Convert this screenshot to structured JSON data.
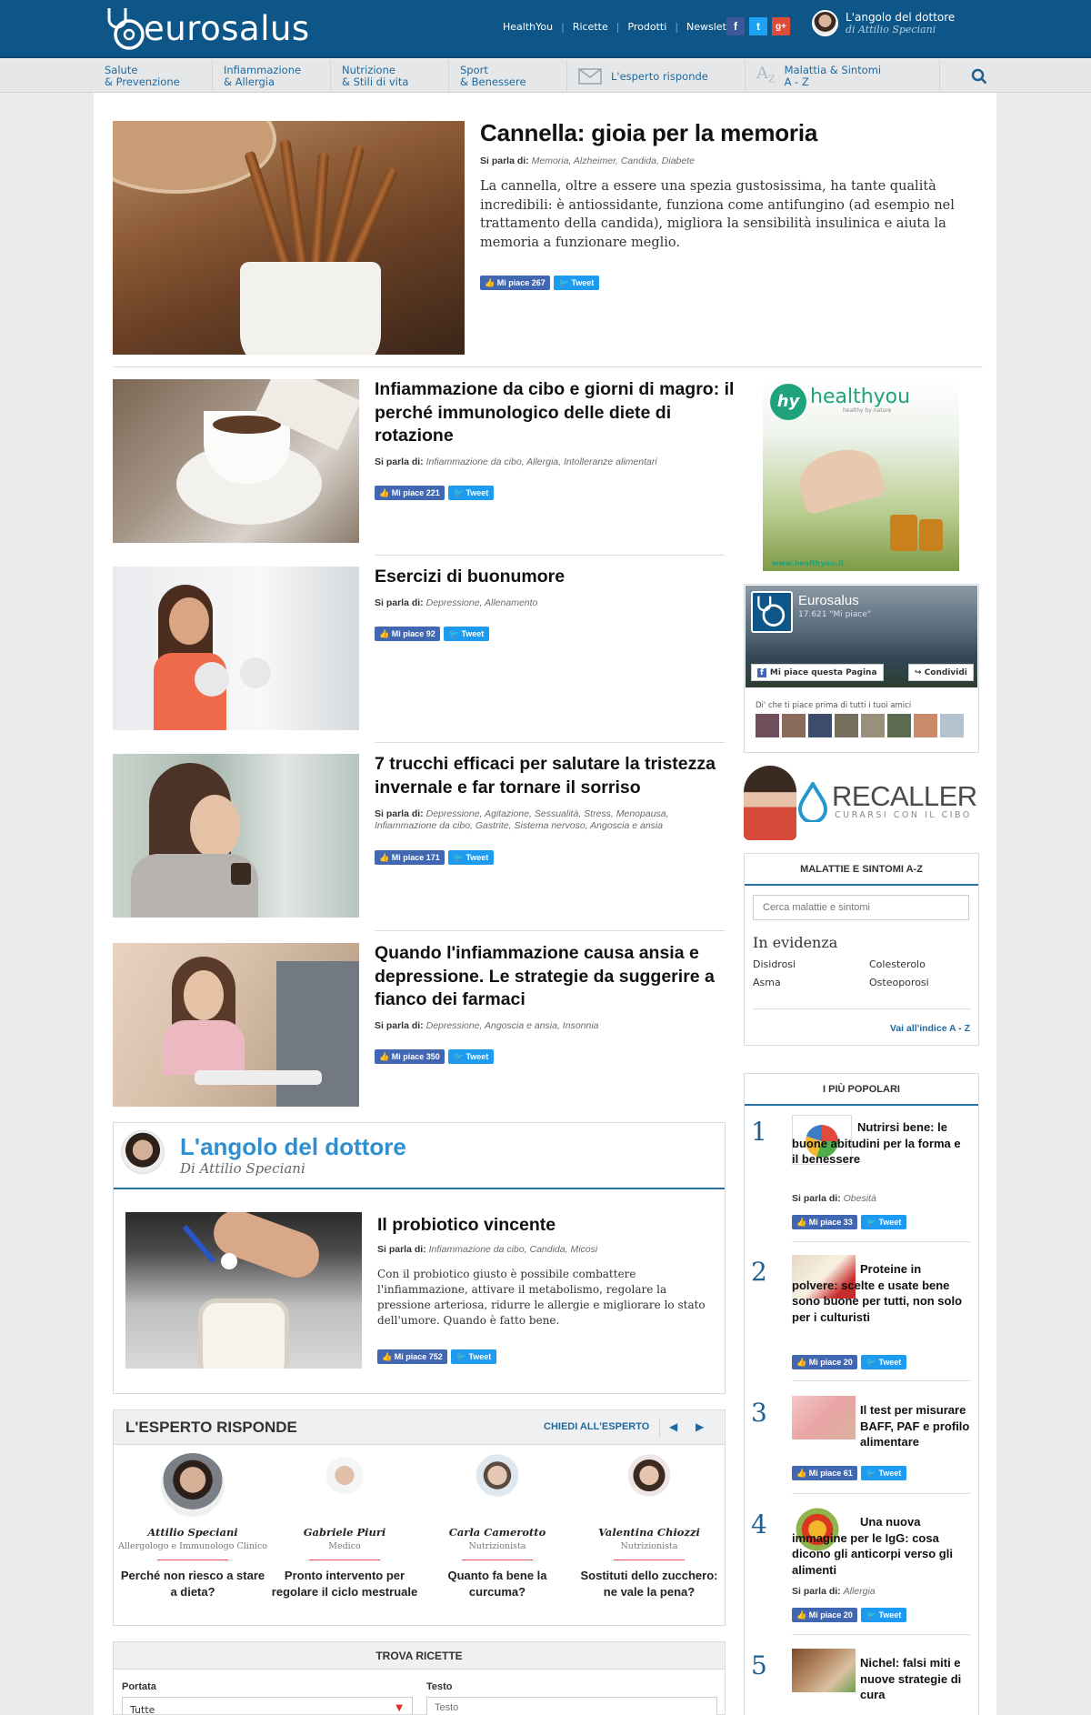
{
  "header": {
    "logo_text": "eurosalus",
    "links": [
      "HealthYou",
      "Ricette",
      "Prodotti",
      "Newsletter"
    ],
    "social": [
      "f",
      "t",
      "g+"
    ],
    "doctor_corner": {
      "title": "L'angolo del dottore",
      "subtitle": "di Attilio Speciani"
    }
  },
  "nav": {
    "items": [
      {
        "line1": "Salute",
        "line2": "& Prevenzione"
      },
      {
        "line1": "Infiammazione",
        "line2": "& Allergia"
      },
      {
        "line1": "Nutrizione",
        "line2": "& Stili di vita"
      },
      {
        "line1": "Sport",
        "line2": "& Benessere"
      }
    ],
    "expert": "L'esperto risponde",
    "az": {
      "line1": "Malattia & Sintomi",
      "line2": "A - Z"
    }
  },
  "hero": {
    "title": "Cannella: gioia per la memoria",
    "tags_label": "Si parla di:",
    "tags": "Memoria, Alzheimer, Candida, Diabete",
    "description": "La cannella, oltre a essere una spezia gustosissima, ha tante qualità incredibili: è antiossidante, funziona come antifungino (ad esempio nel trattamento della candida), migliora la sensibilità insulinica e aiuta la memoria a funzionare meglio.",
    "likes": "Mi piace 267",
    "tweet": "Tweet"
  },
  "articles": [
    {
      "title": "Infiammazione da cibo e giorni di magro: il perché immunologico delle diete di rotazione",
      "tags": "Infiammazione da cibo, Allergia, Intolleranze alimentari",
      "likes": "Mi piace 221"
    },
    {
      "title": "Esercizi di buonumore",
      "tags": "Depressione, Allenamento",
      "likes": "Mi piace 92"
    },
    {
      "title": "7 trucchi efficaci per salutare la tristezza invernale e far tornare il sorriso",
      "tags": "Depressione, Agitazione, Sessualità, Stress, Menopausa, Infiammazione da cibo, Gastrite, Sistema nervoso, Angoscia e ansia",
      "likes": "Mi piace 171"
    },
    {
      "title": "Quando l'infiammazione causa ansia e depressione. Le strategie da suggerire a fianco dei farmaci",
      "tags": "Depressione, Angoscia e ansia, Insonnia",
      "likes": "Mi piace 350"
    }
  ],
  "doctor_box": {
    "title": "L'angolo del dottore",
    "author": "Di Attilio Speciani",
    "article": {
      "title": "Il probiotico vincente",
      "tags": "Infiammazione da cibo, Candida, Micosi",
      "description": "Con il probiotico giusto è possibile combattere l'infiammazione, attivare il metabolismo, regolare la pressione arteriosa, ridurre le allergie e migliorare lo stato dell'umore. Quando è fatto bene.",
      "likes": "Mi piace 752"
    }
  },
  "expert": {
    "title": "L'ESPERTO RISPONDE",
    "ask": "CHIEDI ALL'ESPERTO",
    "experts": [
      {
        "name": "Attilio Speciani",
        "role": "Allergologo e Immunologo Clinico",
        "question": "Perché non riesco a stare a dieta?"
      },
      {
        "name": "Gabriele Piuri",
        "role": "Medico",
        "question": "Pronto intervento per regolare il ciclo mestruale"
      },
      {
        "name": "Carla Camerotto",
        "role": "Nutrizionista",
        "question": "Quanto fa bene la curcuma?"
      },
      {
        "name": "Valentina Chiozzi",
        "role": "Nutrizionista",
        "question": "Sostituti dello zucchero: ne vale la pena?"
      }
    ]
  },
  "ricette": {
    "title": "TROVA RICETTE",
    "portata_label": "Portata",
    "portata_value": "Tutte",
    "testo_label": "Testo",
    "testo_placeholder": "Testo"
  },
  "sidebar": {
    "healthyou": {
      "brand": "healthyou",
      "tagline": "healthy by nature",
      "url": "www.healthyou.it"
    },
    "fb": {
      "name": "Eurosalus",
      "likes": "17.621 \"Mi piace\"",
      "like_btn": "Mi piace questa Pagina",
      "share_btn": "Condividi",
      "friends": "Di' che ti piace prima di tutti i tuoi amici"
    },
    "recaller": {
      "brand": "RECALLER",
      "tagline": "CURARSI CON IL CIBO"
    },
    "az": {
      "title": "MALATTIE E SINTOMI A-Z",
      "placeholder": "Cerca malattie e sintomi",
      "featured_title": "In evidenza",
      "items": [
        "Disidrosi",
        "Colesterolo",
        "Asma",
        "Osteoporosi"
      ],
      "link": "Vai all'indice A - Z"
    },
    "popular": {
      "title": "I PIÙ POPOLARI",
      "items": [
        {
          "num": "1",
          "title": "Nutrirsi bene: le buone abitudini per la forma e il benessere",
          "tags": "Obesità",
          "likes": "Mi piace 33"
        },
        {
          "num": "2",
          "title": "Proteine in polvere: scelte e usate bene sono buone per tutti, non solo per i culturisti",
          "tags": "",
          "likes": "Mi piace 20"
        },
        {
          "num": "3",
          "title": "Il test per misurare BAFF, PAF e profilo alimentare",
          "tags": "",
          "likes": "Mi piace 61"
        },
        {
          "num": "4",
          "title": "Una nuova immagine per le IgG: cosa dicono gli anticorpi verso gli alimenti",
          "tags": "Allergia",
          "likes": "Mi piace 20"
        },
        {
          "num": "5",
          "title": "Nichel: falsi miti e nuove strategie di cura",
          "tags": "",
          "likes": ""
        }
      ]
    }
  },
  "common": {
    "tags_label": "Si parla di:",
    "tweet": "Tweet"
  }
}
